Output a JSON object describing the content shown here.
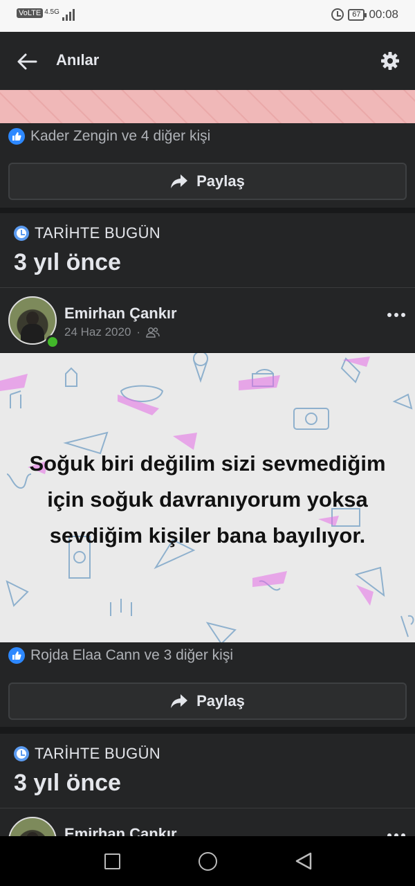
{
  "status_bar": {
    "volte": "VoLTE",
    "network": "4.5G",
    "battery": "67",
    "time": "00:08"
  },
  "header": {
    "title": "Anılar"
  },
  "card1": {
    "reactions_text": "Kader Zengin ve 4 diğer kişi",
    "share_label": "Paylaş"
  },
  "memory1": {
    "section_label": "TARİHTE BUGÜN",
    "years_ago": "3 yıl önce",
    "poster_name": "Emirhan Çankır",
    "date": "24 Haz 2020",
    "separator": "·",
    "post_text_line1": "Soğuk biri değilim sizi sevmediğim",
    "post_text_line2": "için soğuk davranıyorum yoksa",
    "post_text_line3": "sevdiğim kişiler bana bayılıyor.",
    "reactions_text": "Rojda Elaa Cann ve 3 diğer kişi",
    "share_label": "Paylaş"
  },
  "memory2": {
    "section_label": "TARİHTE BUGÜN",
    "years_ago": "3 yıl önce",
    "poster_name": "Emirhan Çankır"
  },
  "colors": {
    "background": "#18191a",
    "card": "#242526",
    "accent_blue": "#2d88ff",
    "online_green": "#42b72a"
  },
  "icons": {
    "back": "arrow-left-icon",
    "settings": "gear-icon",
    "like": "thumbs-up-icon",
    "share": "share-arrow-icon",
    "memory": "clock-icon",
    "audience": "friends-icon",
    "more": "more-dots-icon"
  }
}
